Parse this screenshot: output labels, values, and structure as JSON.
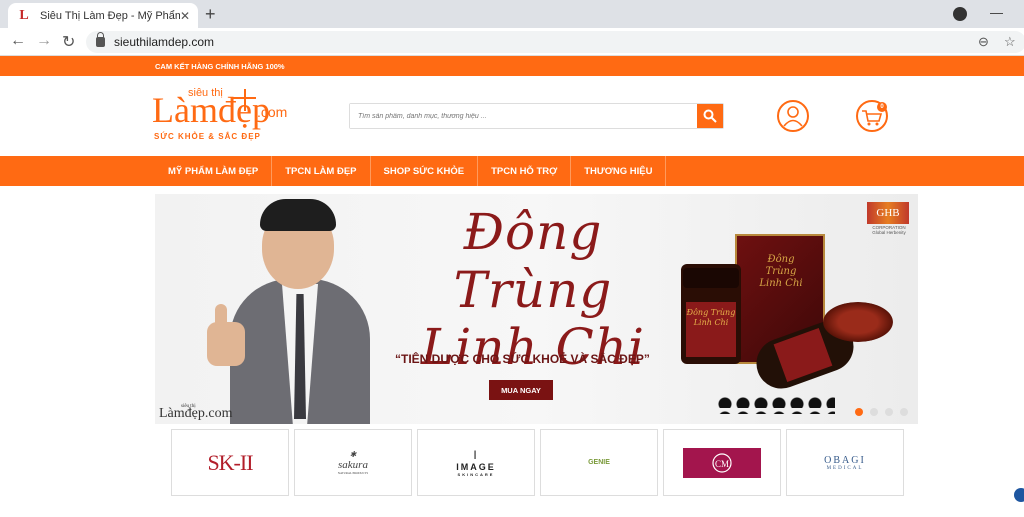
{
  "browser": {
    "tab_favicon": "L",
    "tab_title": "Siêu Thị Làm Đẹp - Mỹ Phẩm & T",
    "close_glyph": "✕",
    "new_tab_glyph": "+",
    "url": "sieuthilamdep.com"
  },
  "site": {
    "promise": "CAM KẾT HÀNG CHÍNH HÃNG 100%",
    "logo": {
      "top": "siêu thị",
      "main": "Làmđẹp",
      "domain": ".com",
      "slogan": "SỨC KHỎE & SẮC ĐẸP"
    },
    "search": {
      "placeholder": "Tìm sản phẩm, danh mục, thương hiệu ..."
    },
    "cart_count": "0",
    "nav": [
      "MỸ PHẨM LÀM ĐẸP",
      "TPCN LÀM ĐẸP",
      "SHOP SỨC KHỎE",
      "TPCN HỖ TRỢ",
      "THƯƠNG HIỆU"
    ],
    "banner": {
      "headline_line1": "Đông Trùng",
      "headline_line2": "Linh Chi",
      "tagline": "“TIÊN DƯỢC CHO SỨC KHOẺ VÀ SẮC ĐẸP”",
      "cta": "MUA NGAY",
      "brand_mark": "GHB",
      "brand_sub": "CORPORATION Global Herbenity",
      "box_label": "Đông Trùng Linh Chi",
      "jar_label": "Đông Trùng Linh Chi",
      "watermark_top": "siêu thị",
      "watermark_main": "Làmđẹp.com",
      "slide_count": 4,
      "active_slide": 0
    },
    "brands": [
      {
        "name": "SK-II"
      },
      {
        "name": "sakura",
        "sub": "NATURAL PRODUCTS"
      },
      {
        "name": "IMAGE",
        "sub": "SKINCARE"
      },
      {
        "name": "GENIE"
      },
      {
        "name": "CM"
      },
      {
        "name": "OBAGI",
        "sub": "MEDICAL"
      }
    ]
  },
  "colors": {
    "accent": "#ff6a13",
    "banner_red": "#8b1a1a"
  }
}
